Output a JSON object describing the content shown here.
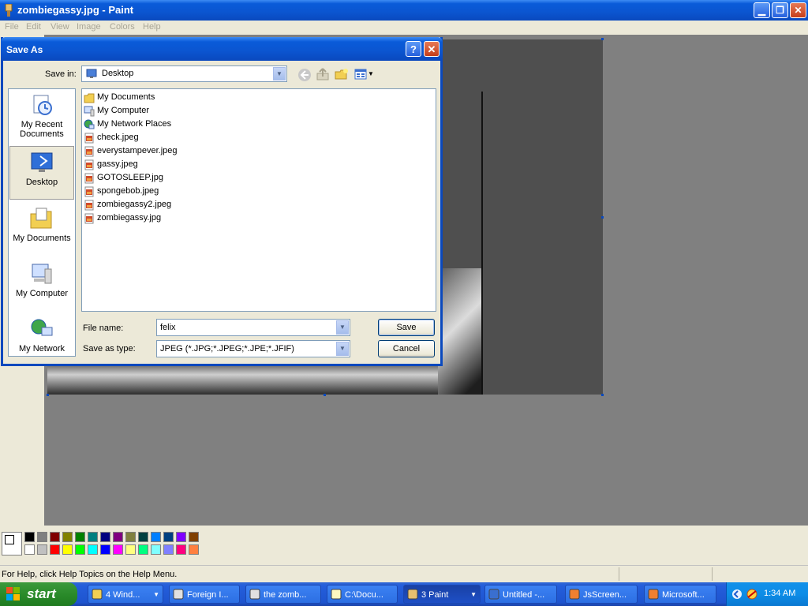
{
  "window": {
    "title": "zombiegassy.jpg - Paint"
  },
  "menu": [
    "File",
    "Edit",
    "View",
    "Image",
    "Colors",
    "Help"
  ],
  "status": {
    "help_text": "For Help, click Help Topics on the Help Menu."
  },
  "palette": {
    "top": [
      "#000000",
      "#808080",
      "#800000",
      "#808000",
      "#008000",
      "#008080",
      "#000080",
      "#800080",
      "#808040",
      "#004040",
      "#0080ff",
      "#004080",
      "#8000ff",
      "#804000"
    ],
    "bottom": [
      "#ffffff",
      "#c0c0c0",
      "#ff0000",
      "#ffff00",
      "#00ff00",
      "#00ffff",
      "#0000ff",
      "#ff00ff",
      "#ffff80",
      "#00ff80",
      "#80ffff",
      "#8080ff",
      "#ff0080",
      "#ff8040"
    ]
  },
  "dialog": {
    "title": "Save As",
    "help_glyph": "?",
    "close_glyph": "✕",
    "save_in_label": "Save in:",
    "save_in_value": "Desktop",
    "places": [
      {
        "label": "My Recent Documents",
        "icon": "recent-documents-icon"
      },
      {
        "label": "Desktop",
        "icon": "desktop-icon"
      },
      {
        "label": "My Documents",
        "icon": "my-documents-icon"
      },
      {
        "label": "My Computer",
        "icon": "my-computer-icon"
      },
      {
        "label": "My Network",
        "icon": "my-network-icon"
      }
    ],
    "files": [
      {
        "name": "My Documents",
        "icon": "folder-icon"
      },
      {
        "name": "My Computer",
        "icon": "computer-icon"
      },
      {
        "name": "My Network Places",
        "icon": "network-places-icon"
      },
      {
        "name": "check.jpeg",
        "icon": "jpeg-file-icon"
      },
      {
        "name": "everystampever.jpeg",
        "icon": "jpeg-file-icon"
      },
      {
        "name": "gassy.jpeg",
        "icon": "jpeg-file-icon"
      },
      {
        "name": "GOTOSLEEP.jpg",
        "icon": "jpeg-file-icon"
      },
      {
        "name": "spongebob.jpeg",
        "icon": "jpeg-file-icon"
      },
      {
        "name": "zombiegassy2.jpeg",
        "icon": "jpeg-file-icon"
      },
      {
        "name": "zombiegassy.jpg",
        "icon": "jpeg-file-icon"
      }
    ],
    "file_name_label": "File name:",
    "file_name_value": "felix",
    "save_type_label": "Save as type:",
    "save_type_value": "JPEG (*.JPG;*.JPEG;*.JPE;*.JFIF)",
    "save_button": "Save",
    "cancel_button": "Cancel"
  },
  "taskbar": {
    "start_label": "start",
    "tasks": [
      {
        "label": "4 Wind...",
        "icon": "folder-icon",
        "group": true
      },
      {
        "label": "Foreign I...",
        "icon": "browser-icon",
        "group": false
      },
      {
        "label": "the zomb...",
        "icon": "browser-icon",
        "group": false
      },
      {
        "label": "C:\\Docu...",
        "icon": "notepad-icon",
        "group": false
      },
      {
        "label": "3 Paint",
        "icon": "paint-icon",
        "group": true,
        "active": true
      },
      {
        "label": "Untitled -...",
        "icon": "word-icon",
        "group": false
      },
      {
        "label": "JsScreen...",
        "icon": "app-icon",
        "group": false
      },
      {
        "label": "Microsoft...",
        "icon": "app-icon",
        "group": false
      }
    ],
    "clock": "1:34 AM"
  }
}
